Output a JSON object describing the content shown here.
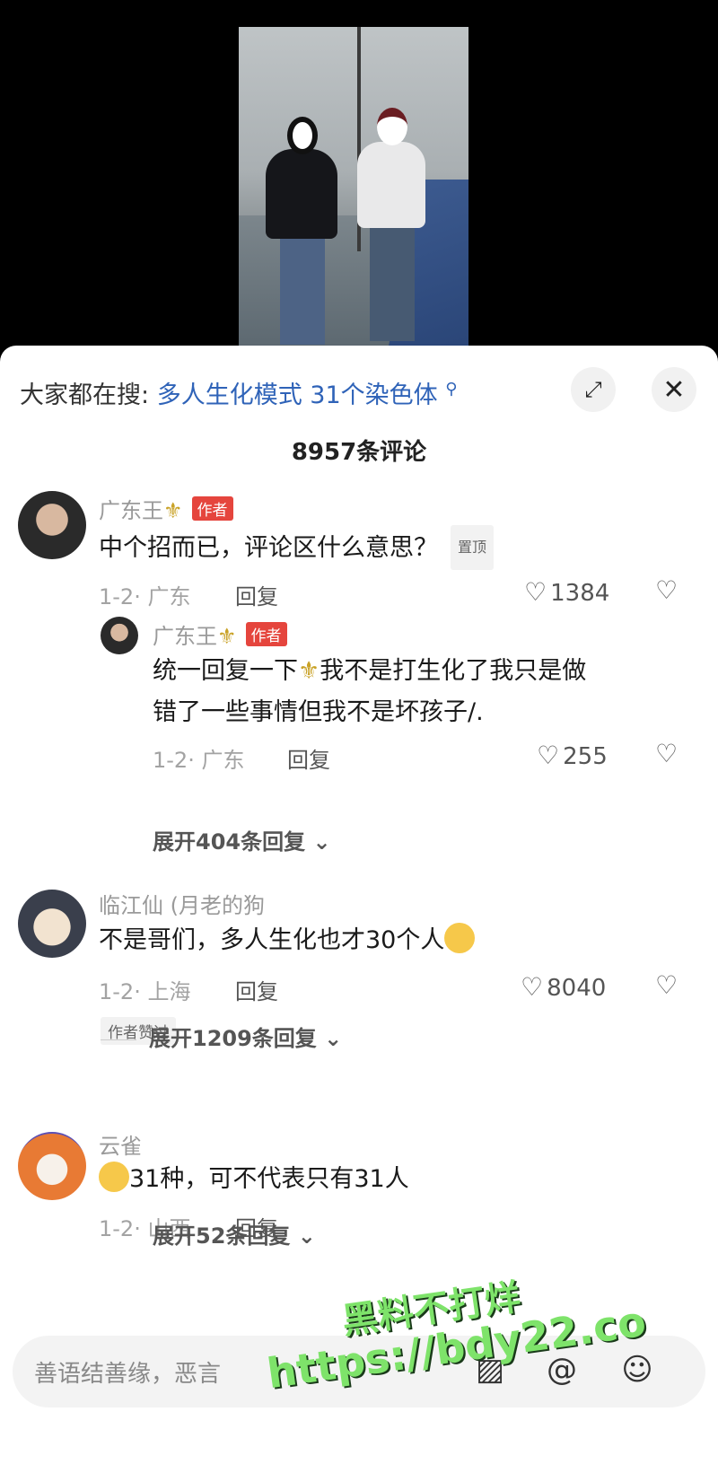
{
  "search_bar": {
    "prefix": "大家都在搜:",
    "term": "多人生化模式 31个染色体",
    "search_icon": "search-icon"
  },
  "top_buttons": {
    "expand_icon": "expand-icon",
    "close_symbol": "✕"
  },
  "comment_count": "8957条评论",
  "author_tag": "作者",
  "pinned_tag": "置顶",
  "reply_label": "回复",
  "comments": [
    {
      "user": "广东王",
      "text": "中个招而已，评论区什么意思？",
      "date_location": "1-2· 广东",
      "likes": "1384",
      "reply": {
        "user": "广东王",
        "text_line1_pre": "统一回复一下",
        "text_line1_post": "我不是打生化了我只是做",
        "text_line2": "错了一些事情但我不是坏孩子/.",
        "date_location": "1-2· 广东",
        "likes": "255"
      },
      "expand": "展开404条回复"
    },
    {
      "user": "临江仙 (月老的狗",
      "text": "不是哥们，多人生化也才30个人",
      "date_location": "1-2· 上海",
      "likes": "8040",
      "author_liked": "作者赞过",
      "expand": "展开1209条回复"
    },
    {
      "user": "云雀",
      "text": "31种，可不代表只有31人",
      "date_location": "1-2· 山西",
      "expand": "展开52条回复"
    }
  ],
  "input_bar": {
    "placeholder": "善语结善缘，恶言"
  },
  "watermark": {
    "line1": "黑料不打烊",
    "line2": "https://bdy22.co"
  }
}
